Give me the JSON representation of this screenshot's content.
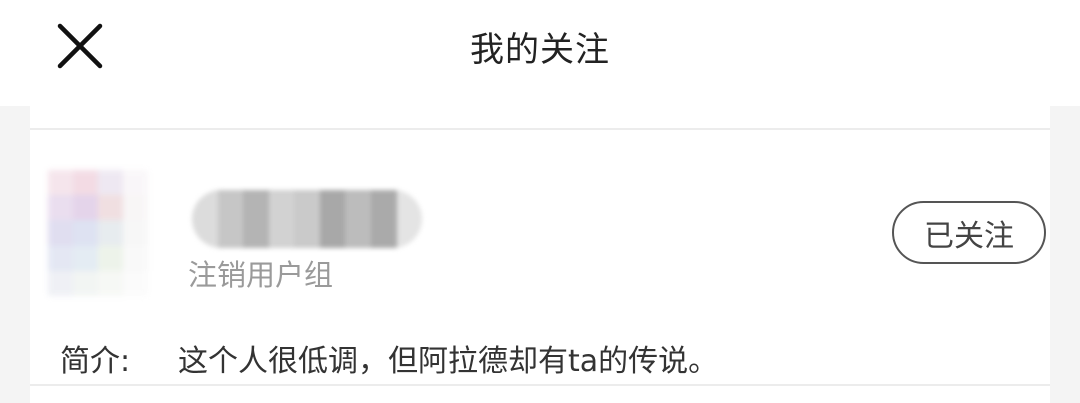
{
  "header": {
    "title": "我的关注",
    "close_icon": "close-icon"
  },
  "follow_list": [
    {
      "group": "注销用户组",
      "follow_label": "已关注",
      "bio_label": "简介:",
      "bio_text": "这个人很低调，但阿拉德却有ta的传说。"
    }
  ],
  "colors": {
    "header_bg": "#ffffff",
    "page_bg": "#f4f4f4",
    "text_primary": "#222222",
    "text_secondary": "#9a9a9a",
    "button_border": "#555555"
  }
}
